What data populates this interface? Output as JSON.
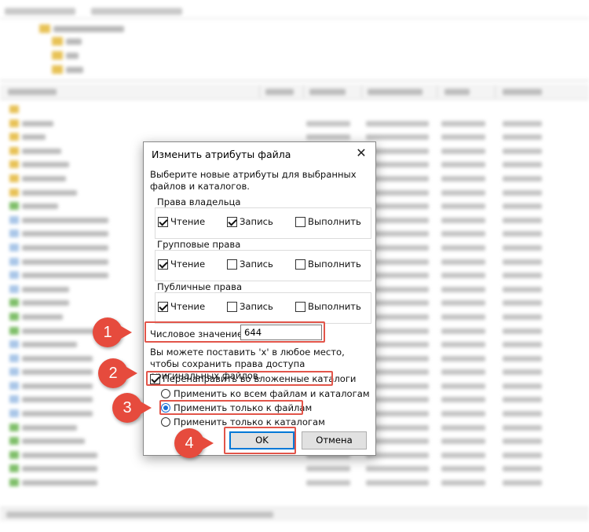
{
  "dialog": {
    "title": "Изменить атрибуты файла",
    "prompt": "Выберите новые атрибуты для выбранных файлов и каталогов.",
    "owner": {
      "label": "Права владельца",
      "read": {
        "label": "Чтение",
        "checked": true
      },
      "write": {
        "label": "Запись",
        "checked": true
      },
      "execute": {
        "label": "Выполнить",
        "checked": false
      }
    },
    "group": {
      "label": "Групповые права",
      "read": {
        "label": "Чтение",
        "checked": true
      },
      "write": {
        "label": "Запись",
        "checked": false
      },
      "execute": {
        "label": "Выполнить",
        "checked": false
      }
    },
    "public": {
      "label": "Публичные права",
      "read": {
        "label": "Чтение",
        "checked": true
      },
      "write": {
        "label": "Запись",
        "checked": false
      },
      "execute": {
        "label": "Выполнить",
        "checked": false
      }
    },
    "numeric_label": "Числовое значение:",
    "numeric_value": "644",
    "hint": "Вы можете поставить 'x' в любое место, чтобы сохранить права доступа оригинальных файлов.",
    "recurse": {
      "label": "Перенаправить во вложенные каталоги",
      "checked": true
    },
    "apply_all": {
      "label": "Применить ко всем файлам и каталогам",
      "selected": false
    },
    "apply_files": {
      "label": "Применить только к файлам",
      "selected": true
    },
    "apply_dirs": {
      "label": "Применить только к каталогам",
      "selected": false
    },
    "ok": "OK",
    "cancel": "Отмена"
  },
  "callouts": [
    "1",
    "2",
    "3",
    "4"
  ],
  "colors": {
    "callout": "#e64b3d",
    "highlight": "#e2554a",
    "accent": "#0078d7"
  }
}
